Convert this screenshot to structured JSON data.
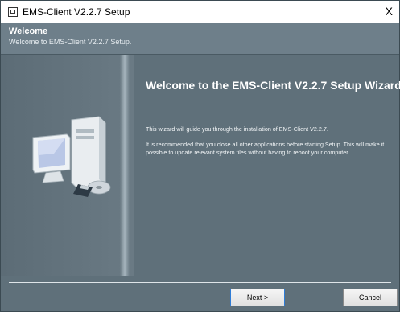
{
  "window": {
    "title": "EMS-Client V2.2.7 Setup",
    "close_symbol": "X"
  },
  "header": {
    "title": "Welcome",
    "subtitle": "Welcome to EMS-Client V2.2.7 Setup."
  },
  "main": {
    "heading": "Welcome to the EMS-Client V2.2.7 Setup Wizard",
    "paragraphs": [
      "This wizard will guide you through the installation of EMS-Client V2.2.7.",
      "It is recommended that you close all other applications before starting Setup. This will make it possible to update relevant system files without having to reboot your computer."
    ],
    "illustration": "computer-setup-illustration"
  },
  "buttons": {
    "next": "Next >",
    "cancel": "Cancel"
  },
  "colors": {
    "background": "#5f707a",
    "header": "#6e7f8a",
    "focus_border": "#2f7cd6"
  }
}
